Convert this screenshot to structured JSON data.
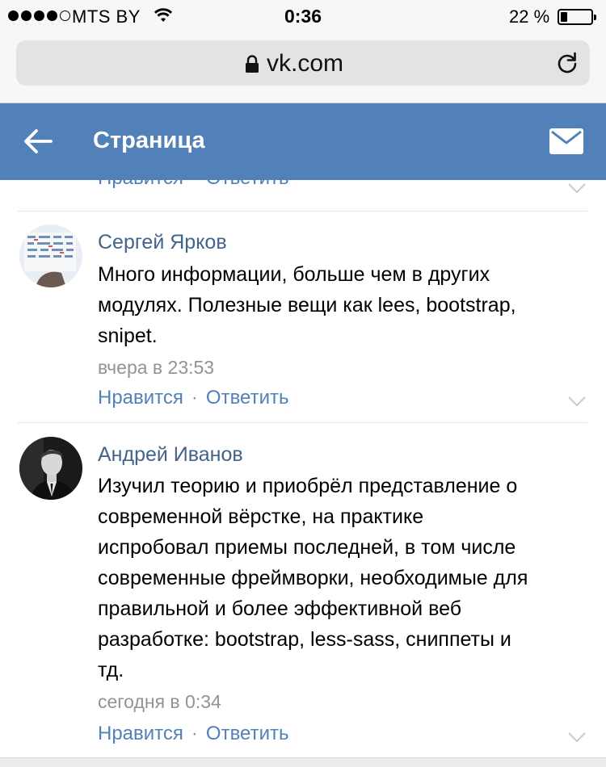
{
  "status_bar": {
    "carrier": "MTS BY",
    "time": "0:36",
    "battery_percent_label": "22 %",
    "battery_level": 0.22,
    "signal_bars_filled": 4,
    "signal_bars_total": 5
  },
  "browser": {
    "url": "vk.com"
  },
  "header": {
    "title": "Страница",
    "background_color": "#5181b8",
    "icons": [
      "back-arrow-icon",
      "mail-icon"
    ]
  },
  "previous_comment_actions": {
    "like_label": "Нравится",
    "separator": "·",
    "reply_label": "Ответить"
  },
  "comments": [
    {
      "author": "Сергей Ярков",
      "text_lines": [
        "Много информации, больше чем в других",
        "модулях. Полезные вещи как lees, bootstrap,",
        "snipet."
      ],
      "date": "вчера в 23:53",
      "like_label": "Нравится",
      "separator": "·",
      "reply_label": "Ответить"
    },
    {
      "author": "Андрей Иванов",
      "text_lines": [
        "Изучил теорию и приобрёл представление о",
        "современной вёрстке, на практике",
        "испробовал приемы последней, в том числе",
        "современные фреймворки, необходимые для",
        "правильной и более эффективной веб",
        "разработке: bootstrap, less-sass, сниппеты и",
        "тд."
      ],
      "date": "сегодня в 0:34",
      "like_label": "Нравится",
      "separator": "·",
      "reply_label": "Ответить"
    }
  ],
  "colors": {
    "link": "#5181b8",
    "author": "#42648b",
    "meta": "#939393"
  }
}
